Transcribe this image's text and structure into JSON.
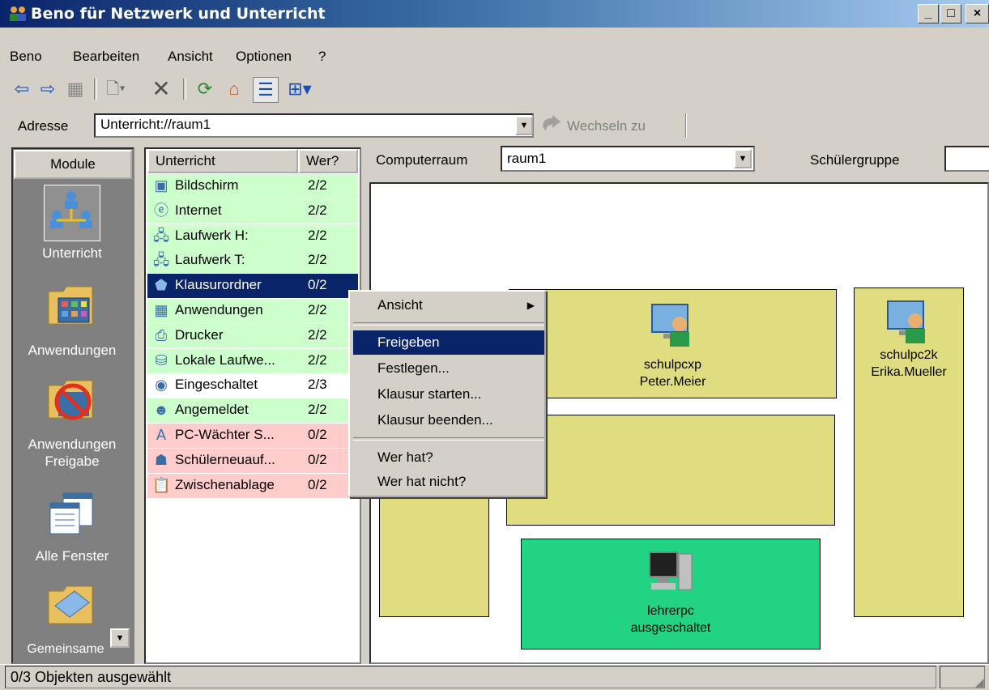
{
  "window": {
    "title": "Beno für Netzwerk und Unterricht",
    "controls": [
      "_",
      "□",
      "×"
    ]
  },
  "menu": [
    "Beno",
    "Bearbeiten",
    "Ansicht",
    "Optionen",
    "?"
  ],
  "toolbar": {
    "icons": [
      "back-arrow-icon",
      "forward-arrow-icon",
      "up-folder-icon",
      "new-document-icon",
      "delete-icon",
      "refresh-icon",
      "home-icon",
      "list-view-icon",
      "details-view-icon"
    ]
  },
  "address": {
    "label": "Adresse",
    "value": "Unterricht://raum1",
    "go_label": "Wechseln zu"
  },
  "modules": {
    "header": "Module",
    "items": [
      {
        "label": "Unterricht",
        "icon": "network-users-icon"
      },
      {
        "label": "Anwendungen",
        "icon": "applications-folder-icon"
      },
      {
        "label": "Anwendungen\nFreigabe",
        "icon": "forbidden-folder-icon"
      },
      {
        "label": "Alle Fenster",
        "icon": "windows-icon"
      },
      {
        "label": "Gemeinsame",
        "icon": "shared-folder-icon"
      }
    ]
  },
  "list": {
    "headers": [
      "Unterricht",
      "Wer?"
    ],
    "rows": [
      {
        "name": "Bildschirm",
        "who": "2/2",
        "status": "green",
        "icon": "screen-icon"
      },
      {
        "name": "Internet",
        "who": "2/2",
        "status": "green",
        "icon": "internet-icon"
      },
      {
        "name": "Laufwerk H:",
        "who": "2/2",
        "status": "green",
        "icon": "network-drive-icon"
      },
      {
        "name": "Laufwerk T:",
        "who": "2/2",
        "status": "green",
        "icon": "network-drive-icon"
      },
      {
        "name": "Klausurordner",
        "who": "0/2",
        "status": "selected",
        "icon": "exam-folder-icon"
      },
      {
        "name": "Anwendungen",
        "who": "2/2",
        "status": "green",
        "icon": "applications-icon"
      },
      {
        "name": "Drucker",
        "who": "2/2",
        "status": "green",
        "icon": "printer-icon"
      },
      {
        "name": "Lokale Laufwe...",
        "who": "2/2",
        "status": "green",
        "icon": "local-drive-icon"
      },
      {
        "name": "Eingeschaltet",
        "who": "2/3",
        "status": "white",
        "icon": "power-icon"
      },
      {
        "name": "Angemeldet",
        "who": "2/2",
        "status": "green",
        "icon": "user-icon"
      },
      {
        "name": "PC-Wächter S...",
        "who": "0/2",
        "status": "red",
        "icon": "guard-icon"
      },
      {
        "name": "Schülerneuauf...",
        "who": "0/2",
        "status": "red",
        "icon": "students-icon"
      },
      {
        "name": "Zwischenablage",
        "who": "0/2",
        "status": "red",
        "icon": "clipboard-icon"
      }
    ]
  },
  "room": {
    "computerraum_label": "Computerraum",
    "computerraum_value": "raum1",
    "schuelergruppe_label": "Schülergruppe",
    "pcs": [
      {
        "name": "schulpcxp",
        "user": "Peter.Meier"
      },
      {
        "name": "schulpc2k",
        "user": "Erika.Mueller"
      },
      {
        "name": "lehrerpc",
        "user": "ausgeschaltet"
      }
    ]
  },
  "context_menu": {
    "items": [
      "Ansicht",
      "Freigeben",
      "Festlegen...",
      "Klausur starten...",
      "Klausur beenden...",
      "Wer hat?",
      "Wer hat nicht?"
    ],
    "highlighted": "Freigeben"
  },
  "status": {
    "text": "0/3 Objekten ausgewählt"
  },
  "colors": {
    "green": "#ccffcc",
    "red": "#ffcccc",
    "selected": "#0a246a",
    "room_box": "#e0dc80",
    "teacher_box": "#22d384"
  }
}
